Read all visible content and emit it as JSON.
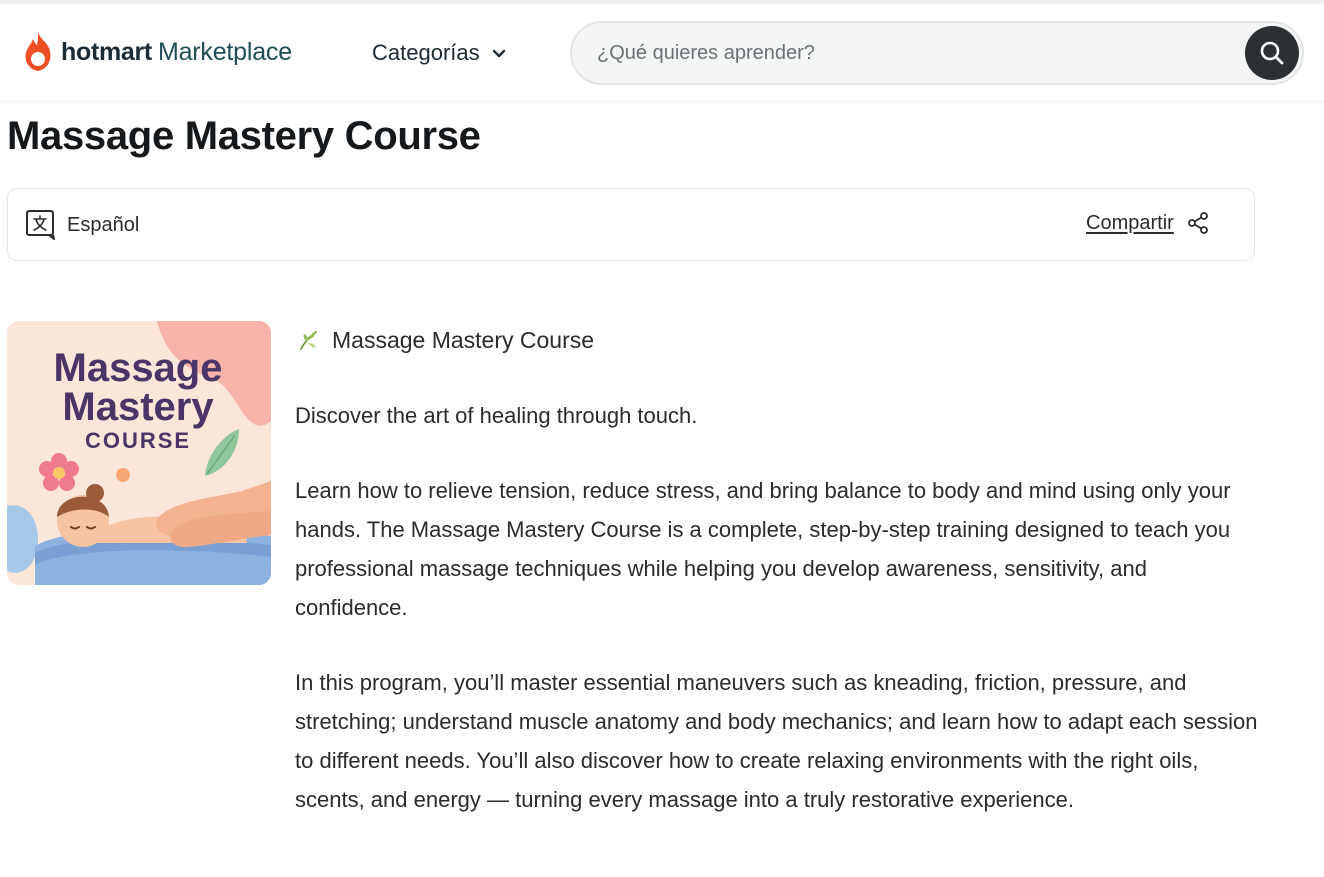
{
  "header": {
    "brand_bold": "hotmart",
    "brand_light": "Marketplace",
    "categories_label": "Categorías",
    "search_placeholder": "¿Qué quieres aprender?",
    "accent_color": "#f04e23"
  },
  "page": {
    "title": "Massage Mastery Course"
  },
  "infobar": {
    "language": "Español",
    "share_label": "Compartir"
  },
  "product_image": {
    "line1": "Massage",
    "line2": "Mastery",
    "line3": "COURSE"
  },
  "description": {
    "heading": "Massage Mastery Course",
    "heading_icon": "leaf-icon",
    "paragraphs": [
      "Discover the art of healing through touch.",
      "Learn how to relieve tension, reduce stress, and bring balance to body and mind using only your hands. The Massage Mastery Course is a complete, step-by-step training designed to teach you professional massage techniques while helping you develop awareness, sensitivity, and confidence.",
      "In this program, you’ll master essential maneuvers such as kneading, friction, pressure, and stretching; understand muscle anatomy and body mechanics; and learn how to adapt each session to different needs. You’ll also discover how to create relaxing environments with the right oils, scents, and energy — turning every massage into a truly restorative experience."
    ]
  }
}
